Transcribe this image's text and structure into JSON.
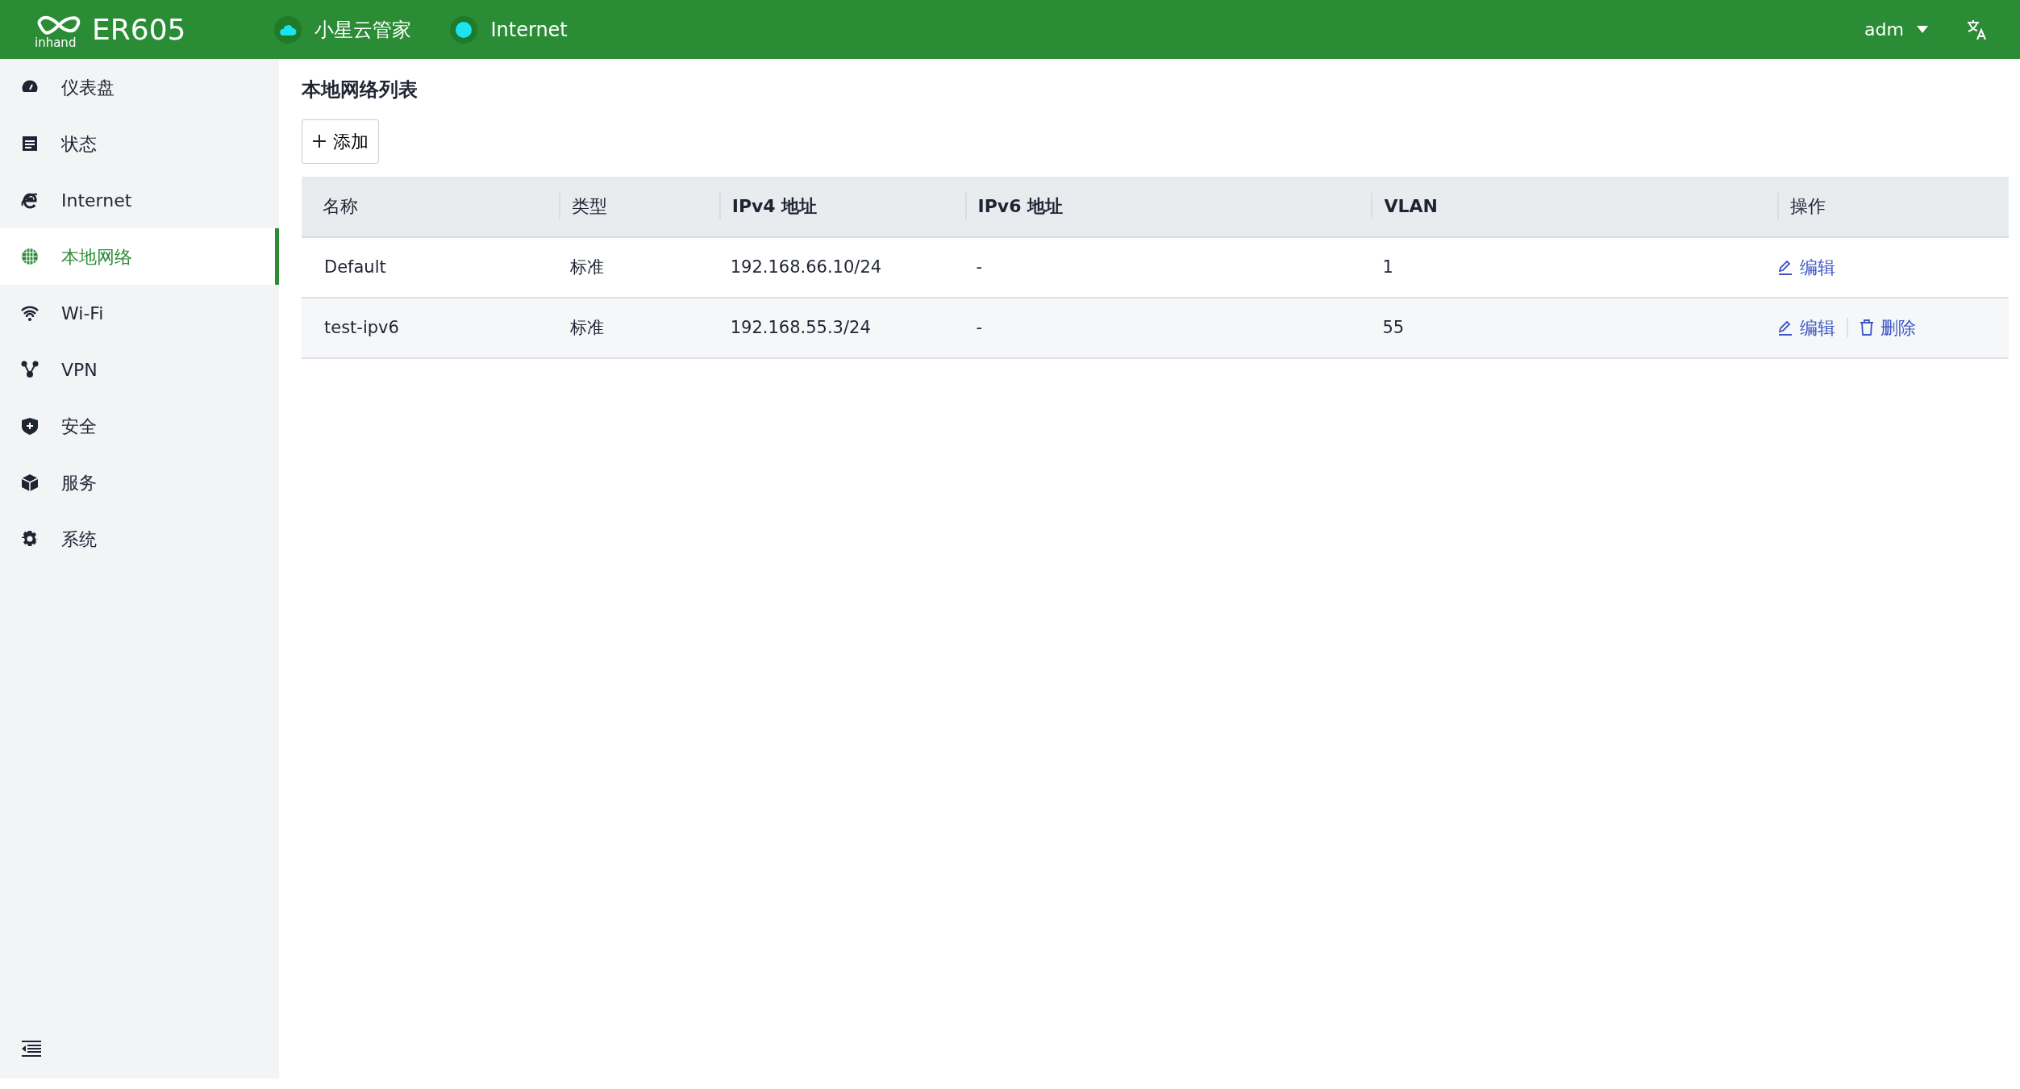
{
  "header": {
    "logo_text": "inhand",
    "product": "ER605",
    "status_items": [
      {
        "kind": "cloud",
        "label": "小星云管家"
      },
      {
        "kind": "dot",
        "label": "Internet"
      }
    ],
    "user": "adm"
  },
  "sidebar": {
    "items": [
      {
        "label": "仪表盘",
        "selected": false
      },
      {
        "label": "状态",
        "selected": false
      },
      {
        "label": "Internet",
        "selected": false
      },
      {
        "label": "本地网络",
        "selected": true
      },
      {
        "label": "Wi-Fi",
        "selected": false
      },
      {
        "label": "VPN",
        "selected": false
      },
      {
        "label": "安全",
        "selected": false
      },
      {
        "label": "服务",
        "selected": false
      },
      {
        "label": "系统",
        "selected": false
      }
    ]
  },
  "page": {
    "title": "本地网络列表",
    "add_button": "添加"
  },
  "table": {
    "columns": [
      "名称",
      "类型",
      "IPv4 地址",
      "IPv6 地址",
      "VLAN",
      "操作"
    ],
    "rows": [
      {
        "cells": [
          "Default",
          "标准",
          "192.168.66.10/24",
          "-",
          "1"
        ],
        "actions": [
          {
            "kind": "edit",
            "label": "编辑"
          }
        ]
      },
      {
        "cells": [
          "test-ipv6",
          "标准",
          "192.168.55.3/24",
          "-",
          "55"
        ],
        "actions": [
          {
            "kind": "edit",
            "label": "编辑"
          },
          {
            "kind": "delete",
            "label": "删除"
          }
        ]
      }
    ]
  }
}
